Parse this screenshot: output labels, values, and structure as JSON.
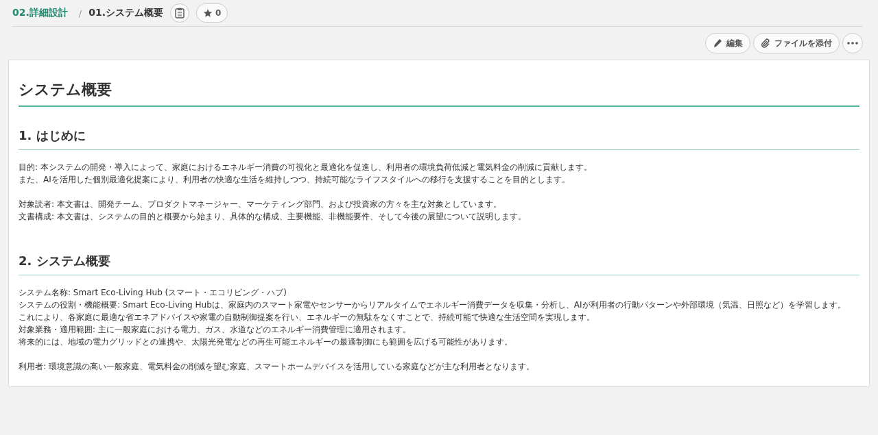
{
  "breadcrumb": {
    "parent": "02.詳細設計",
    "separator": "/",
    "current": "01.システム概要",
    "star_count": "0"
  },
  "actions": [
    {
      "kind": "edit",
      "label": "編集"
    },
    {
      "kind": "attach",
      "label": "ファイルを添付"
    },
    {
      "kind": "more"
    }
  ],
  "document": {
    "title": "システム概要",
    "sections": [
      {
        "heading": "1. はじめに",
        "paragraphs": [
          [
            "目的: 本システムの開発・導入によって、家庭におけるエネルギー消費の可視化と最適化を促進し、利用者の環境負荷低減と電気料金の削減に貢献します。",
            "また、AIを活用した個別最適化提案により、利用者の快適な生活を維持しつつ、持続可能なライフスタイルへの移行を支援することを目的とします。"
          ],
          [
            "対象読者: 本文書は、開発チーム、プロダクトマネージャー、マーケティング部門、および投資家の方々を主な対象としています。",
            "文書構成: 本文書は、システムの目的と概要から始まり、具体的な構成、主要機能、非機能要件、そして今後の展望について説明します。"
          ]
        ]
      },
      {
        "heading": "2. システム概要",
        "paragraphs": [
          [
            "システム名称: Smart Eco-Living Hub (スマート・エコリビング・ハブ)",
            "システムの役割・機能概要: Smart Eco-Living Hubは、家庭内のスマート家電やセンサーからリアルタイムでエネルギー消費データを収集・分析し、AIが利用者の行動パターンや外部環境（気温、日照など）を学習します。",
            "これにより、各家庭に最適な省エネアドバイスや家電の自動制御提案を行い、エネルギーの無駄をなくすことで、持続可能で快適な生活空間を実現します。",
            "対象業務・適用範囲: 主に一般家庭における電力、ガス、水道などのエネルギー消費管理に適用されます。",
            "将来的には、地域の電力グリッドとの連携や、太陽光発電などの再生可能エネルギーの最適制御にも範囲を広げる可能性があります。"
          ],
          [
            "利用者: 環境意識の高い一般家庭、電気料金の削減を望む家庭、スマートホームデバイスを活用している家庭などが主な利用者となります。"
          ]
        ]
      }
    ]
  }
}
